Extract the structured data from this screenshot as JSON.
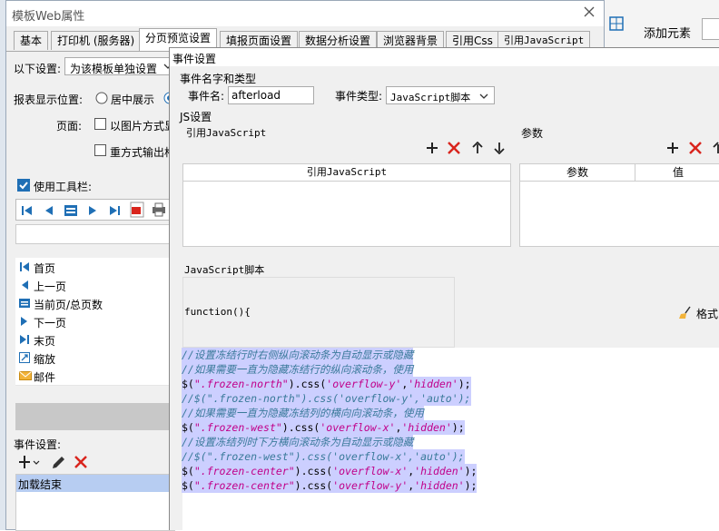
{
  "main_window": {
    "title": "模板Web属性",
    "tabs": [
      "基本",
      "打印机 (服务器)",
      "分页预览设置",
      "填报页面设置",
      "数据分析设置",
      "浏览器背景",
      "引用Css",
      "引用JavaScript"
    ],
    "active_tab_index": 2,
    "setting_label": "以下设置:",
    "setting_value": "为该模板单独设置",
    "display_position_label": "报表显示位置:",
    "center_option": "居中展示",
    "page_label": "页面:",
    "image_output_option": "以图片方式显",
    "repeat_output_option": "重方式输出格",
    "use_toolbar_label": "使用工具栏:",
    "use_toolbar_checked": true,
    "toolbar_list": [
      {
        "icon": "first-page-icon",
        "label": "首页"
      },
      {
        "icon": "prev-page-icon",
        "label": "上一页"
      },
      {
        "icon": "page-count-icon",
        "label": "当前页/总页数"
      },
      {
        "icon": "next-page-icon",
        "label": "下一页"
      },
      {
        "icon": "last-page-icon",
        "label": "末页"
      },
      {
        "icon": "zoom-icon",
        "label": "缩放"
      },
      {
        "icon": "mail-icon",
        "label": "邮件"
      }
    ],
    "event_settings_label": "事件设置:",
    "event_list": [
      "加载结束"
    ]
  },
  "background_window": {
    "label_top": "添加元素",
    "label_cut": "添加元素"
  },
  "event_dialog": {
    "title": "事件设置",
    "name_type_group": "事件名字和类型",
    "event_name_label": "事件名:",
    "event_name_value": "afterload",
    "event_type_label": "事件类型:",
    "event_type_value": "JavaScript脚本",
    "js_group": "JS设置",
    "ref_js_label": "引用JavaScript",
    "ref_js_column": "引用JavaScript",
    "params_label": "参数",
    "params_col_param": "参数",
    "params_col_value": "值",
    "script_label": "JavaScript脚本",
    "function_header": "function(){",
    "format_label": "格式",
    "code_lines": [
      [
        {
          "t": "//设置冻结行时右侧纵向滚动条为自动显示或隐藏",
          "c": "comment"
        }
      ],
      [
        {
          "t": "//如果需要一直为隐藏冻结行的纵向滚动条，使用",
          "c": "comment"
        }
      ],
      [
        {
          "t": "$(",
          "c": "plain"
        },
        {
          "t": "\".frozen-north\"",
          "c": "string"
        },
        {
          "t": ").css(",
          "c": "plain"
        },
        {
          "t": "'overflow-y'",
          "c": "string"
        },
        {
          "t": ",",
          "c": "plain"
        },
        {
          "t": "'hidden'",
          "c": "string"
        },
        {
          "t": ");",
          "c": "plain"
        }
      ],
      [
        {
          "t": "//$(\".frozen-north\").css('overflow-y','auto');",
          "c": "comment"
        }
      ],
      [
        {
          "t": "//如果需要一直为隐藏冻结列的横向向滚动条，使用",
          "c": "comment"
        }
      ],
      [
        {
          "t": "$(",
          "c": "plain"
        },
        {
          "t": "\".frozen-west\"",
          "c": "string"
        },
        {
          "t": ").css(",
          "c": "plain"
        },
        {
          "t": "'overflow-x'",
          "c": "string"
        },
        {
          "t": ",",
          "c": "plain"
        },
        {
          "t": "'hidden'",
          "c": "string"
        },
        {
          "t": ");",
          "c": "plain"
        }
      ],
      [
        {
          "t": "//设置冻结列时下方横向滚动条为自动显示或隐藏",
          "c": "comment"
        }
      ],
      [
        {
          "t": "//$(\".frozen-west\").css('overflow-x','auto');",
          "c": "comment"
        }
      ],
      [
        {
          "t": "$(",
          "c": "plain"
        },
        {
          "t": "\".frozen-center\"",
          "c": "string"
        },
        {
          "t": ").css(",
          "c": "plain"
        },
        {
          "t": "'overflow-x'",
          "c": "string"
        },
        {
          "t": ",",
          "c": "plain"
        },
        {
          "t": "'hidden'",
          "c": "string"
        },
        {
          "t": ");",
          "c": "plain"
        }
      ],
      [
        {
          "t": "$(",
          "c": "plain"
        },
        {
          "t": "\".frozen-center\"",
          "c": "string"
        },
        {
          "t": ").css(",
          "c": "plain"
        },
        {
          "t": "'overflow-y'",
          "c": "string"
        },
        {
          "t": ",",
          "c": "plain"
        },
        {
          "t": "'hidden'",
          "c": "string"
        },
        {
          "t": ");",
          "c": "plain"
        }
      ]
    ]
  },
  "colors": {
    "comment": "#3a7a9a",
    "string": "#c0008a",
    "plain": "#000000",
    "selection": "#cccfff",
    "accent_red": "#d9251d",
    "accent_blue": "#1f6fb5"
  }
}
